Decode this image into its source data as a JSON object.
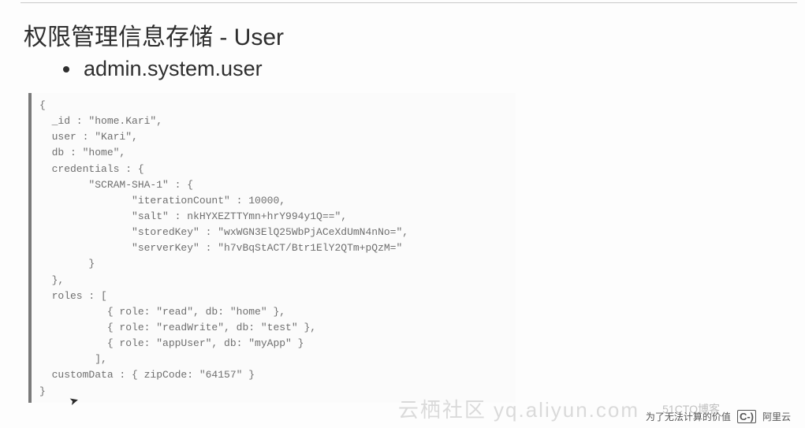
{
  "title": "权限管理信息存储 - User",
  "bullet": "admin.system.user",
  "code": "{\n  _id : \"home.Kari\",\n  user : \"Kari\",\n  db : \"home\",\n  credentials : {\n        \"SCRAM-SHA-1\" : {\n               \"iterationCount\" : 10000,\n               \"salt\" : nkHYXEZTTYmn+hrY994y1Q==\",\n               \"storedKey\" : \"wxWGN3ElQ25WbPjACeXdUmN4nNo=\",\n               \"serverKey\" : \"h7vBqStACT/Btr1ElY2QTm+pQzM=\"\n        }\n  },\n  roles : [\n           { role: \"read\", db: \"home\" },\n           { role: \"readWrite\", db: \"test\" },\n           { role: \"appUser\", db: \"myApp\" }\n         ],\n  customData : { zipCode: \"64157\" }\n}",
  "watermark_main": "云栖社区 yq.aliyun.com",
  "watermark_small": "51CTO博客",
  "footer_text": "为了无法计算的价值",
  "footer_brand": "阿里云",
  "footer_logo_glyph": "C-)"
}
